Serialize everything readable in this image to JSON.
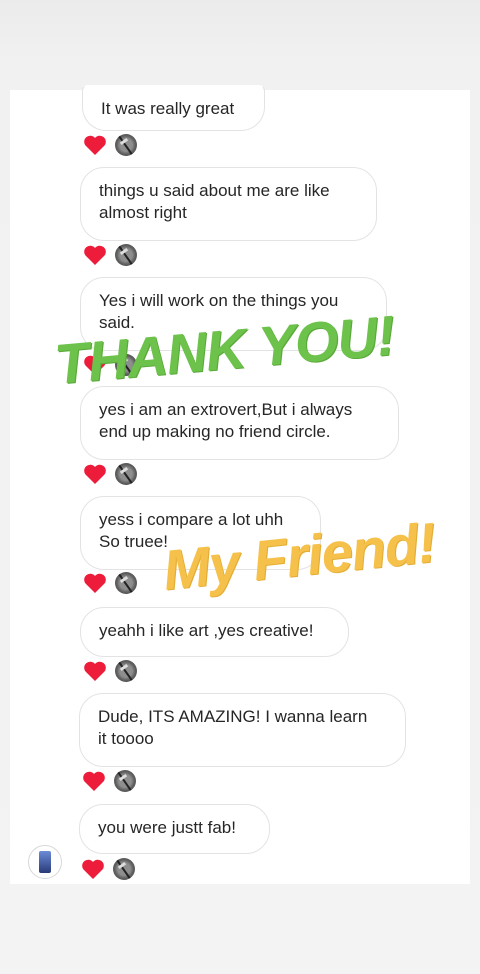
{
  "conversation": {
    "messages": [
      {
        "text": "It was really great",
        "reactions": [
          "heart-icon",
          "reactor-avatar"
        ]
      },
      {
        "text": "things u said about me are like\nalmost right",
        "reactions": [
          "heart-icon",
          "reactor-avatar"
        ]
      },
      {
        "text": "Yes i will work on the things you\nsaid.",
        "reactions": [
          "heart-icon",
          "reactor-avatar"
        ]
      },
      {
        "text": "yes i am an extrovert,But i always\nend up making no friend circle.",
        "reactions": [
          "heart-icon",
          "reactor-avatar"
        ]
      },
      {
        "text": "yess i compare a lot uhh\nSo truee!",
        "reactions": [
          "heart-icon",
          "reactor-avatar"
        ]
      },
      {
        "text": "yeahh i like art ,yes creative!",
        "reactions": [
          "heart-icon",
          "reactor-avatar"
        ]
      },
      {
        "text": "Dude, ITS AMAZING! I wanna learn\nit toooo",
        "reactions": [
          "heart-icon",
          "reactor-avatar"
        ]
      },
      {
        "text": "you were justt fab!",
        "reactions": [
          "heart-icon",
          "reactor-avatar"
        ]
      }
    ]
  },
  "stickers": {
    "thank_you": "THANK YOU!",
    "my_friend": "My Friend!"
  },
  "colors": {
    "heart": "#ed1c3a",
    "thank_you": "#6cc24a",
    "my_friend": "#f5c14b",
    "bubble_border": "#e3e3e3"
  }
}
